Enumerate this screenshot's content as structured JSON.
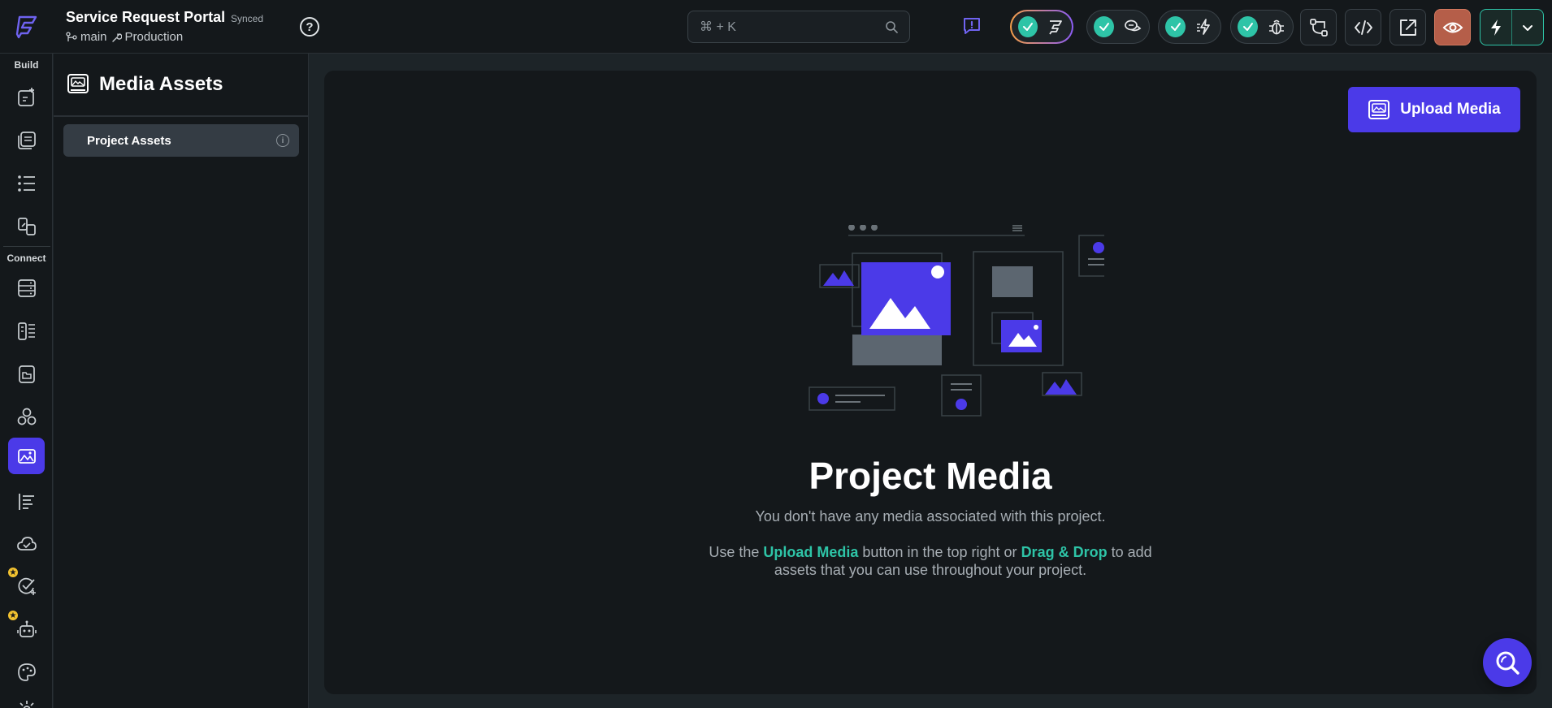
{
  "header": {
    "project_title": "Service Request Portal",
    "sync_status": "Synced",
    "branch": "main",
    "environment": "Production",
    "help_glyph": "?",
    "search_hint": "⌘ + K",
    "status_pills": [
      {
        "icon": "flow-icon",
        "active": true
      },
      {
        "icon": "chat-icon",
        "active": false
      },
      {
        "icon": "actions-icon",
        "active": false
      },
      {
        "icon": "bug-icon",
        "active": false
      }
    ],
    "tools": [
      "branch-icon",
      "code-icon",
      "open-external-icon",
      "preview-eye-icon"
    ],
    "run_icon": "lightning-icon"
  },
  "rail": {
    "build_label": "Build",
    "connect_label": "Connect",
    "active_item": "media-assets"
  },
  "panel": {
    "title": "Media Assets",
    "items": [
      {
        "label": "Project Assets"
      }
    ]
  },
  "main": {
    "upload_label": "Upload Media",
    "empty_title": "Project Media",
    "empty_subtitle": "You don't have any media associated with this project.",
    "hint_prefix": "Use the ",
    "hint_link1": "Upload Media",
    "hint_middle": " button in the top right or ",
    "hint_link2": "Drag & Drop",
    "hint_suffix": " to add assets that you can use throughout your project."
  },
  "colors": {
    "accent": "#4b3ae8",
    "success": "#2ec4a7",
    "background": "#14181b",
    "preview_button": "#b55e49"
  }
}
